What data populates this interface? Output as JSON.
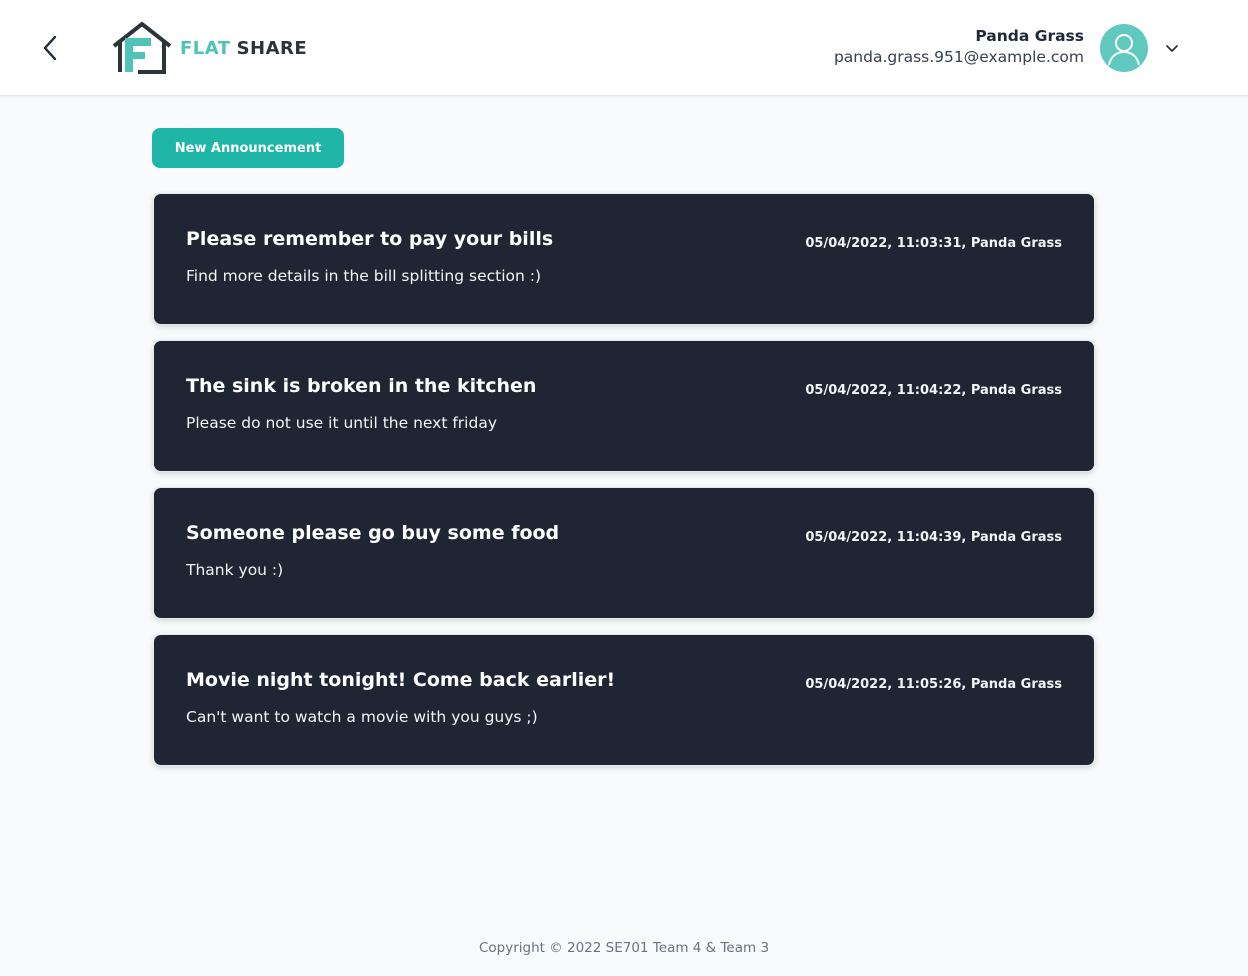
{
  "header": {
    "back_icon": "chevron-left-icon",
    "logo": {
      "flat": "FLAT",
      "share": "SHARE",
      "icon": "house-f-icon"
    },
    "user": {
      "name": "Panda Grass",
      "email": "panda.grass.951@example.com",
      "avatar_icon": "user-avatar-icon"
    },
    "menu_icon": "chevron-down-icon"
  },
  "actions": {
    "new_announcement_label": "New Announcement"
  },
  "announcements": [
    {
      "title": "Please remember to pay your bills",
      "body": "Find more details in the bill splitting section :)",
      "meta": "05/04/2022, 11:03:31, Panda Grass"
    },
    {
      "title": "The sink is broken in the kitchen",
      "body": "Please do not use it until the next friday",
      "meta": "05/04/2022, 11:04:22, Panda Grass"
    },
    {
      "title": "Someone please go buy some food",
      "body": "Thank you :)",
      "meta": "05/04/2022, 11:04:39, Panda Grass"
    },
    {
      "title": "Movie night tonight! Come back earlier!",
      "body": "Can't want to watch a movie with you guys ;)",
      "meta": "05/04/2022, 11:05:26, Panda Grass"
    }
  ],
  "footer": {
    "copyright": "Copyright © 2022 SE701 Team 4 & Team 3"
  },
  "colors": {
    "accent": "#1fb5a7",
    "logo_teal": "#4fc3b7",
    "card_bg": "#1f2532",
    "page_bg": "#f8fafc"
  }
}
